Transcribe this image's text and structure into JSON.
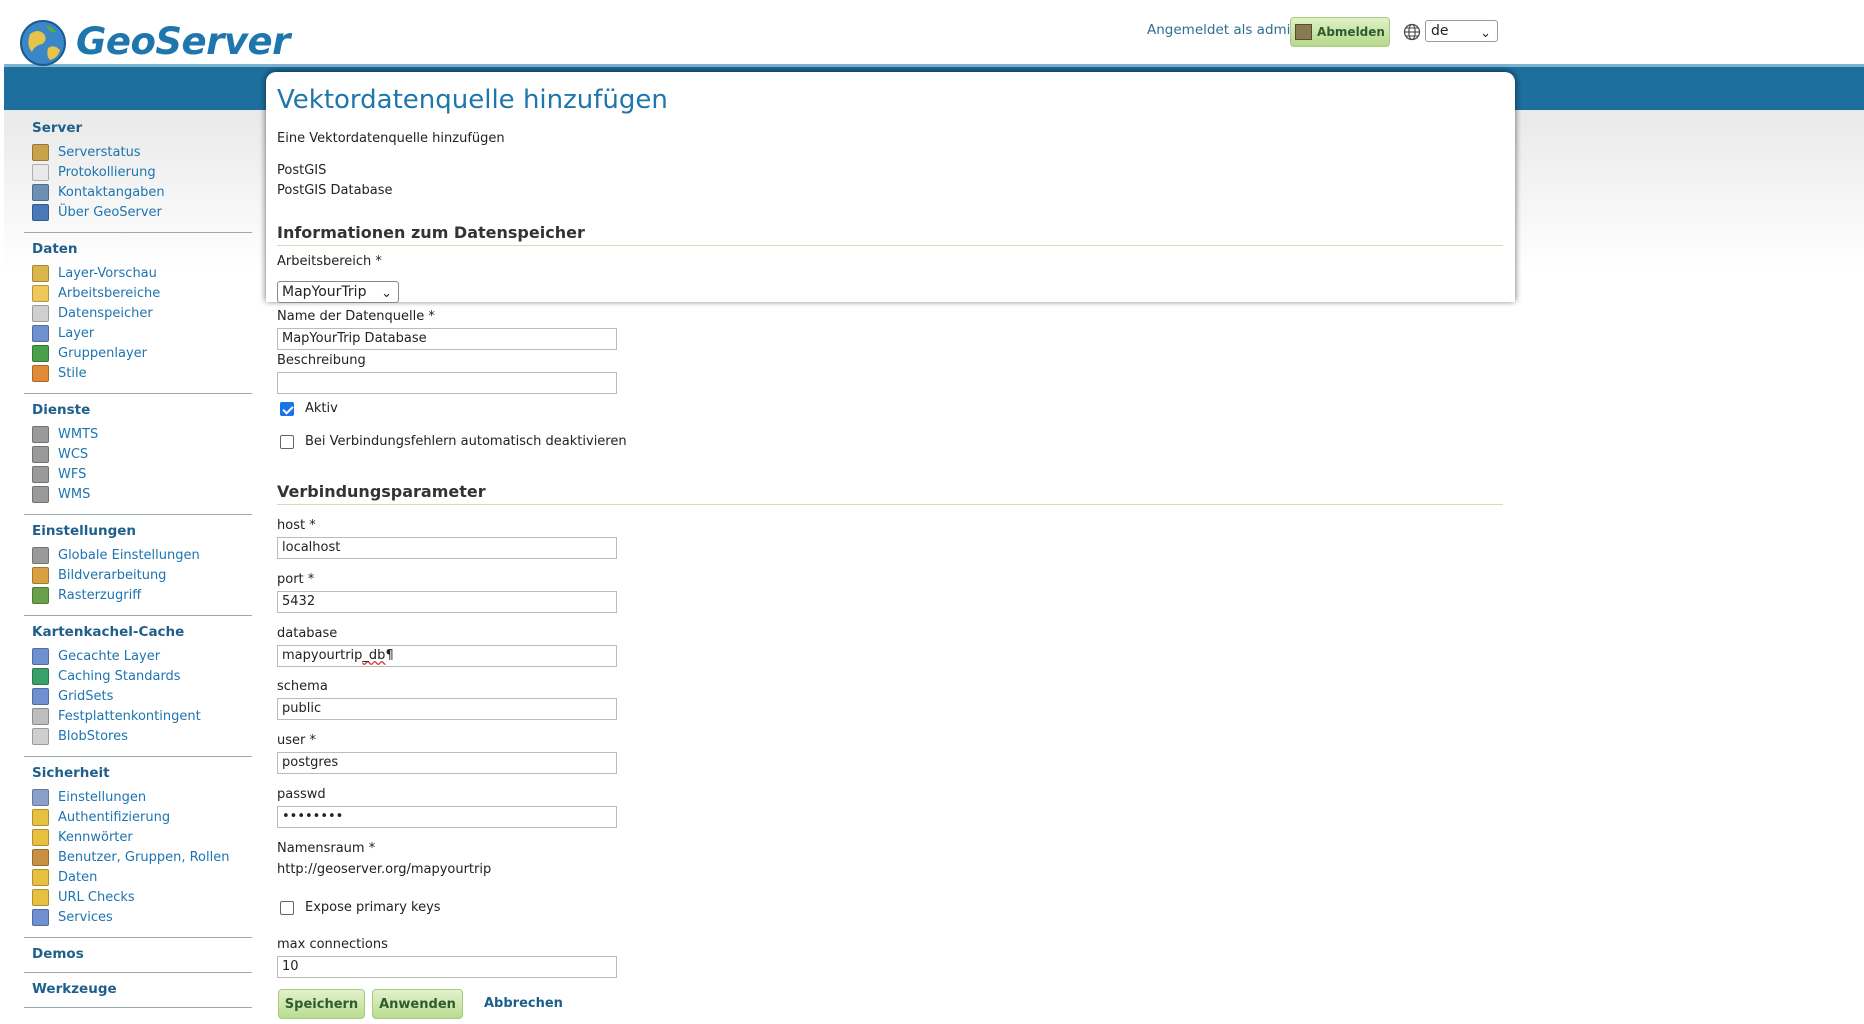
{
  "header": {
    "logo_text": "GeoServer",
    "login_text": "Angemeldet als admin.",
    "logout_label": "Abmelden",
    "language": "de"
  },
  "sidebar": [
    {
      "title": "Server",
      "items": [
        {
          "label": "Serverstatus",
          "icon": "server-status-icon",
          "color": "#c9a24a"
        },
        {
          "label": "Protokollierung",
          "icon": "log-document-icon",
          "color": "#e9e9e9"
        },
        {
          "label": "Kontaktangaben",
          "icon": "contact-card-icon",
          "color": "#6d8fb3"
        },
        {
          "label": "Über GeoServer",
          "icon": "about-help-icon",
          "color": "#4a78b8"
        }
      ]
    },
    {
      "title": "Daten",
      "items": [
        {
          "label": "Layer-Vorschau",
          "icon": "layer-preview-icon",
          "color": "#d8b64a"
        },
        {
          "label": "Arbeitsbereiche",
          "icon": "workspace-folder-icon",
          "color": "#f0c85a"
        },
        {
          "label": "Datenspeicher",
          "icon": "datastore-icon",
          "color": "#cfcfcf"
        },
        {
          "label": "Layer",
          "icon": "layer-icon",
          "color": "#6e8fd0"
        },
        {
          "label": "Gruppenlayer",
          "icon": "layer-group-icon",
          "color": "#4aa04a"
        },
        {
          "label": "Stile",
          "icon": "style-palette-icon",
          "color": "#e08a3a"
        }
      ]
    },
    {
      "title": "Dienste",
      "items": [
        {
          "label": "WMTS",
          "icon": "wmts-service-icon",
          "color": "#9a9a9a"
        },
        {
          "label": "WCS",
          "icon": "wcs-service-icon",
          "color": "#9a9a9a"
        },
        {
          "label": "WFS",
          "icon": "wfs-service-icon",
          "color": "#9a9a9a"
        },
        {
          "label": "WMS",
          "icon": "wms-service-icon",
          "color": "#9a9a9a"
        }
      ]
    },
    {
      "title": "Einstellungen",
      "items": [
        {
          "label": "Globale Einstellungen",
          "icon": "global-settings-icon",
          "color": "#9a9a9a"
        },
        {
          "label": "Bildverarbeitung",
          "icon": "image-processing-icon",
          "color": "#d8a040"
        },
        {
          "label": "Rasterzugriff",
          "icon": "raster-access-icon",
          "color": "#6aa04a"
        }
      ]
    },
    {
      "title": "Kartenkachel-Cache",
      "items": [
        {
          "label": "Gecachte Layer",
          "icon": "cached-layer-icon",
          "color": "#6e8fd0"
        },
        {
          "label": "Caching Standards",
          "icon": "caching-globe-icon",
          "color": "#3aa06a"
        },
        {
          "label": "GridSets",
          "icon": "gridset-icon",
          "color": "#6e8fd0"
        },
        {
          "label": "Festplattenkontingent",
          "icon": "disk-quota-icon",
          "color": "#bdbdbd"
        },
        {
          "label": "BlobStores",
          "icon": "blobstore-icon",
          "color": "#cfcfcf"
        }
      ]
    },
    {
      "title": "Sicherheit",
      "items": [
        {
          "label": "Einstellungen",
          "icon": "wrench-icon",
          "color": "#8aa0c8"
        },
        {
          "label": "Authentifizierung",
          "icon": "shield-icon",
          "color": "#e8c040"
        },
        {
          "label": "Kennwörter",
          "icon": "lock-icon",
          "color": "#e8c040"
        },
        {
          "label": "Benutzer, Gruppen, Rollen",
          "icon": "users-icon",
          "color": "#c89040"
        },
        {
          "label": "Daten",
          "icon": "data-security-icon",
          "color": "#e8c040"
        },
        {
          "label": "URL Checks",
          "icon": "url-check-shield-icon",
          "color": "#e8c040"
        },
        {
          "label": "Services",
          "icon": "services-security-icon",
          "color": "#6e8fd0"
        }
      ]
    },
    {
      "title": "Demos",
      "items": []
    },
    {
      "title": "Werkzeuge",
      "items": []
    }
  ],
  "page": {
    "title": "Vektordatenquelle hinzufügen",
    "subtitle": "Eine Vektordatenquelle hinzufügen",
    "type_name": "PostGIS",
    "type_desc": "PostGIS Database",
    "section_info": "Informationen zum Datenspeicher",
    "workspace_label": "Arbeitsbereich *",
    "workspace_value": "MapYourTrip",
    "name_label": "Name der Datenquelle *",
    "name_value": "MapYourTrip Database",
    "description_label": "Beschreibung",
    "description_value": "",
    "enabled_label": "Aktiv",
    "auto_disable_label": "Bei Verbindungsfehlern automatisch deaktivieren",
    "section_conn": "Verbindungsparameter",
    "host_label": "host *",
    "host_value": "localhost",
    "port_label": "port *",
    "port_value": "5432",
    "database_label": "database",
    "database_value_a": "mapyourtrip",
    "database_value_b": "_db",
    "database_value_c": "¶",
    "schema_label": "schema",
    "schema_value": "public",
    "user_label": "user *",
    "user_value": "postgres",
    "passwd_label": "passwd",
    "passwd_value": "••••••••",
    "namespace_label": "Namensraum *",
    "namespace_value": "http://geoserver.org/mapyourtrip",
    "expose_label": "Expose primary keys",
    "maxconn_label": "max connections",
    "maxconn_value": "10"
  },
  "buttons": {
    "save": "Speichern",
    "apply": "Anwenden",
    "cancel": "Abbrechen"
  }
}
